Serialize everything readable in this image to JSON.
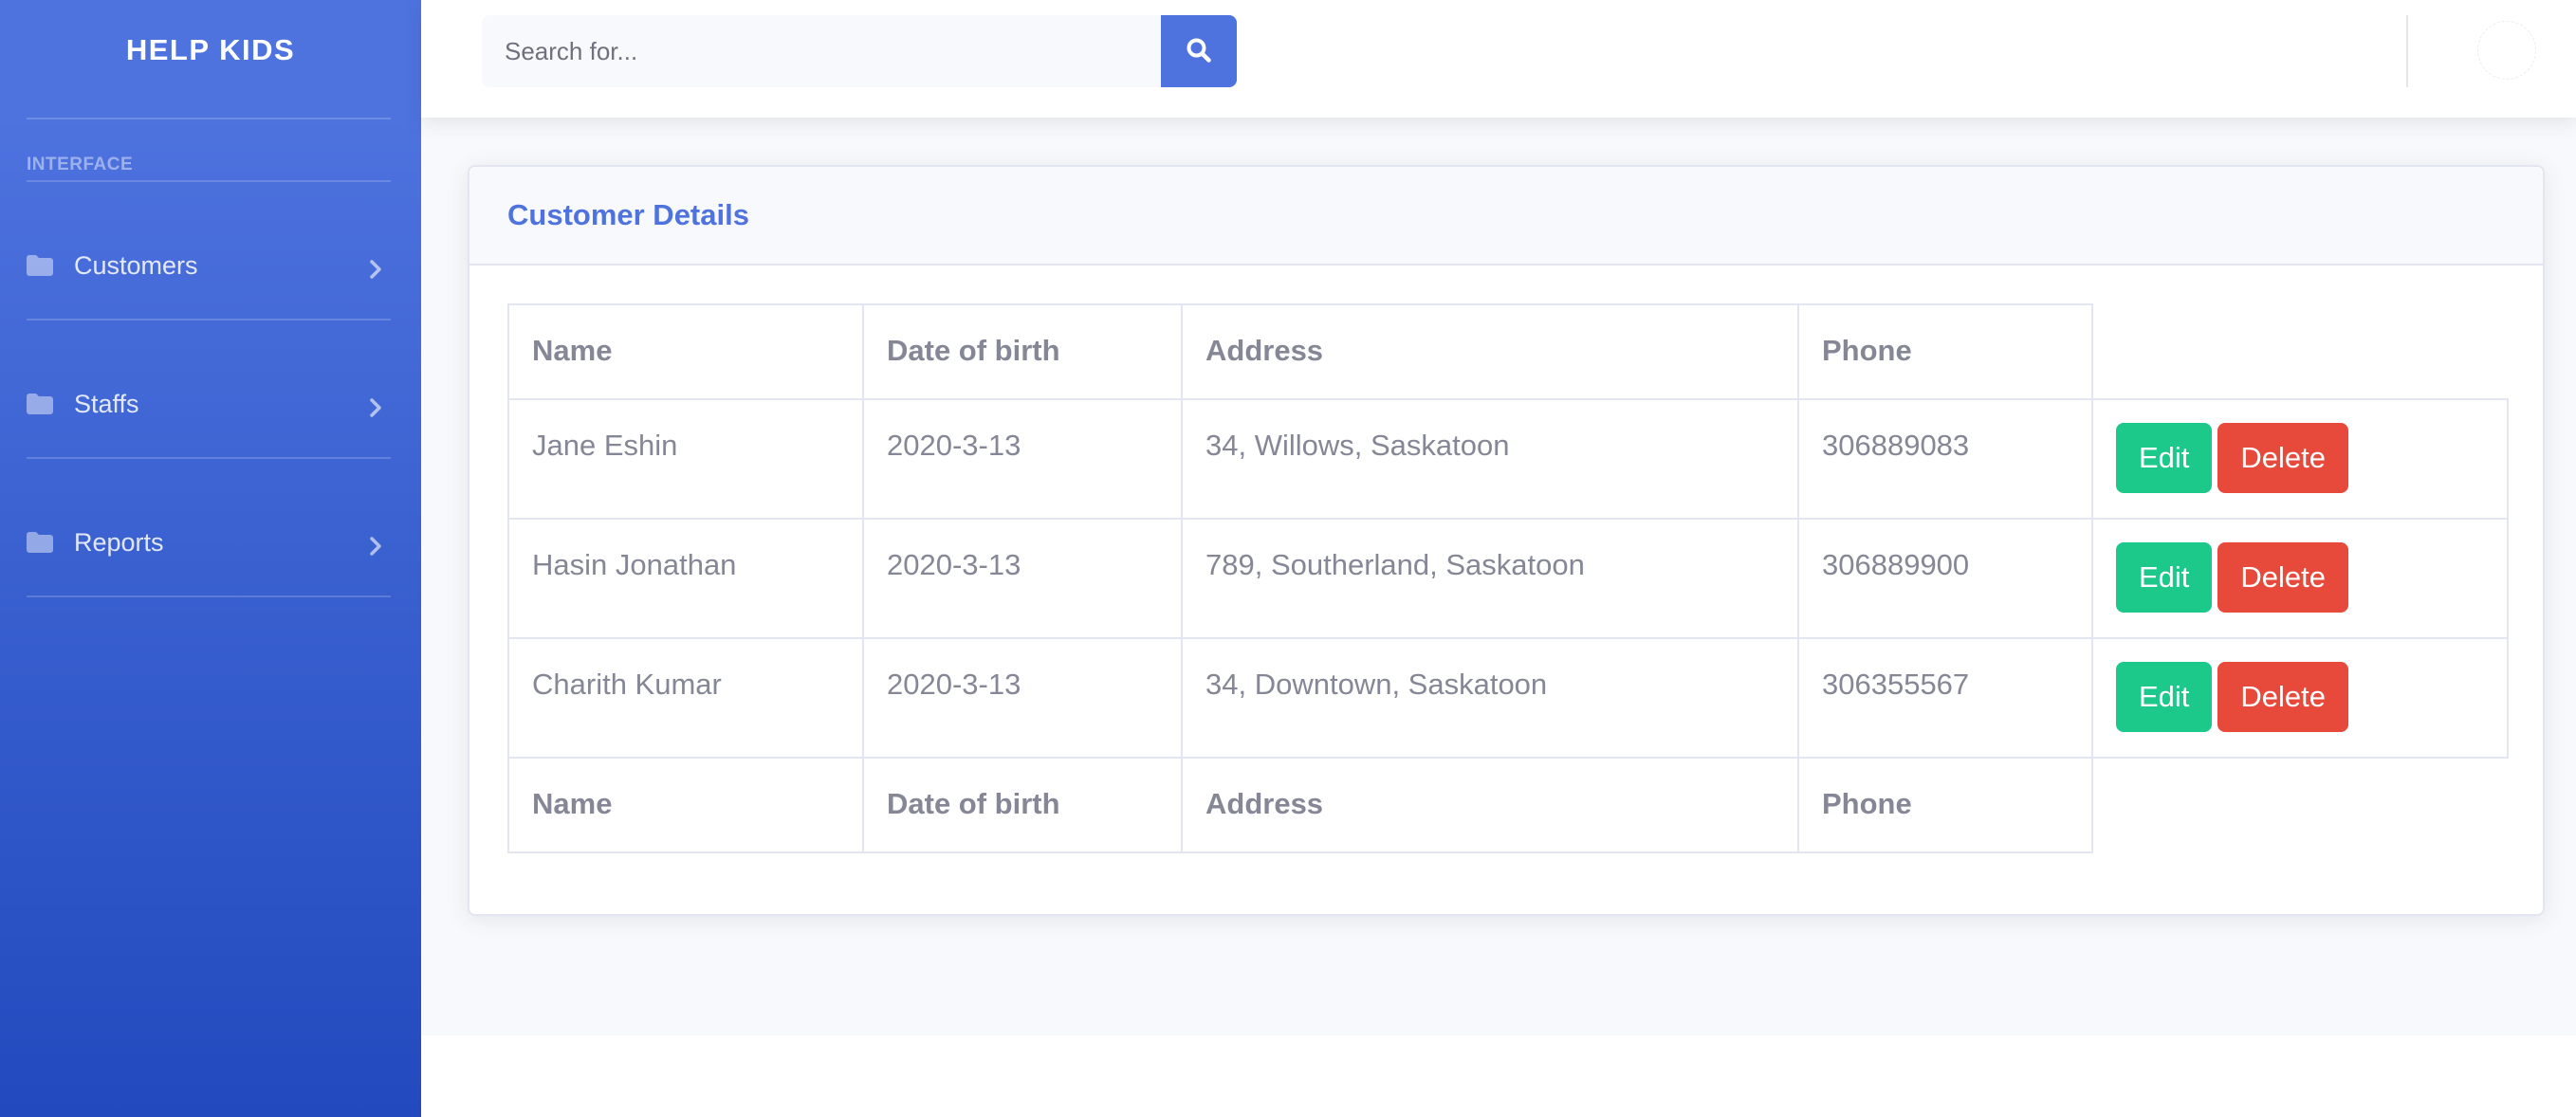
{
  "sidebar": {
    "brand": "HELP KIDS",
    "heading": "INTERFACE",
    "items": [
      {
        "label": "Customers",
        "icon": "folder-icon"
      },
      {
        "label": "Staffs",
        "icon": "folder-icon"
      },
      {
        "label": "Reports",
        "icon": "folder-icon"
      }
    ]
  },
  "topbar": {
    "search_placeholder": "Search for...",
    "search_icon": "search-icon"
  },
  "card": {
    "title": "Customer Details"
  },
  "table": {
    "columns": [
      "Name",
      "Date of birth",
      "Address",
      "Phone"
    ],
    "rows": [
      {
        "name": "Jane Eshin",
        "dob": "2020-3-13",
        "address": "34, Willows, Saskatoon",
        "phone": "306889083"
      },
      {
        "name": "Hasin Jonathan",
        "dob": "2020-3-13",
        "address": "789, Southerland, Saskatoon",
        "phone": "306889900"
      },
      {
        "name": "Charith Kumar",
        "dob": "2020-3-13",
        "address": "34, Downtown, Saskatoon",
        "phone": "306355567"
      }
    ],
    "edit_label": "Edit",
    "delete_label": "Delete"
  },
  "colors": {
    "primary": "#4e73df",
    "success": "#1cc88a",
    "danger": "#e74a3b",
    "text_muted": "#858796"
  }
}
